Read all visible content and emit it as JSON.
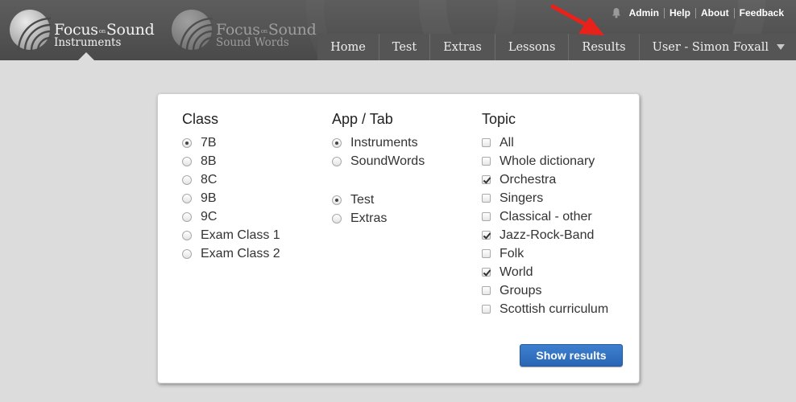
{
  "header": {
    "logo_main": {
      "title_left": "Focus",
      "title_on": "on",
      "title_right": "Sound",
      "subtitle": "Instruments"
    },
    "logo_second": {
      "title_left": "Focus",
      "title_on": "on",
      "title_right": "Sound",
      "subtitle": "Sound Words"
    },
    "top_links": [
      "Admin",
      "Help",
      "About",
      "Feedback"
    ],
    "nav": [
      "Home",
      "Test",
      "Extras",
      "Lessons",
      "Results"
    ],
    "user_menu": "User - Simon Foxall",
    "icons": {
      "bell": "bell-icon",
      "arrow": "red-arrow-annotation",
      "caret": "caret-down-icon"
    },
    "colors": {
      "header_bg": "#4f4f4f",
      "nav_bg": "#555555",
      "arrow": "#e8221b"
    }
  },
  "panel": {
    "class": {
      "heading": "Class",
      "options": [
        {
          "label": "7B",
          "selected": true
        },
        {
          "label": "8B",
          "selected": false
        },
        {
          "label": "8C",
          "selected": false
        },
        {
          "label": "9B",
          "selected": false
        },
        {
          "label": "9C",
          "selected": false
        },
        {
          "label": "Exam Class 1",
          "selected": false
        },
        {
          "label": "Exam Class 2",
          "selected": false
        }
      ]
    },
    "app_tab": {
      "heading": "App / Tab",
      "app_options": [
        {
          "label": "Instruments",
          "selected": true
        },
        {
          "label": "SoundWords",
          "selected": false
        }
      ],
      "tab_options": [
        {
          "label": "Test",
          "selected": true
        },
        {
          "label": "Extras",
          "selected": false
        }
      ]
    },
    "topic": {
      "heading": "Topic",
      "options": [
        {
          "label": "All",
          "checked": false
        },
        {
          "label": "Whole dictionary",
          "checked": false
        },
        {
          "label": "Orchestra",
          "checked": true
        },
        {
          "label": "Singers",
          "checked": false
        },
        {
          "label": "Classical - other",
          "checked": false
        },
        {
          "label": "Jazz-Rock-Band",
          "checked": true
        },
        {
          "label": "Folk",
          "checked": false
        },
        {
          "label": "World",
          "checked": true
        },
        {
          "label": "Groups",
          "checked": false
        },
        {
          "label": "Scottish curriculum",
          "checked": false
        }
      ]
    },
    "button": {
      "label": "Show results",
      "color": "#2f6fbf"
    }
  }
}
